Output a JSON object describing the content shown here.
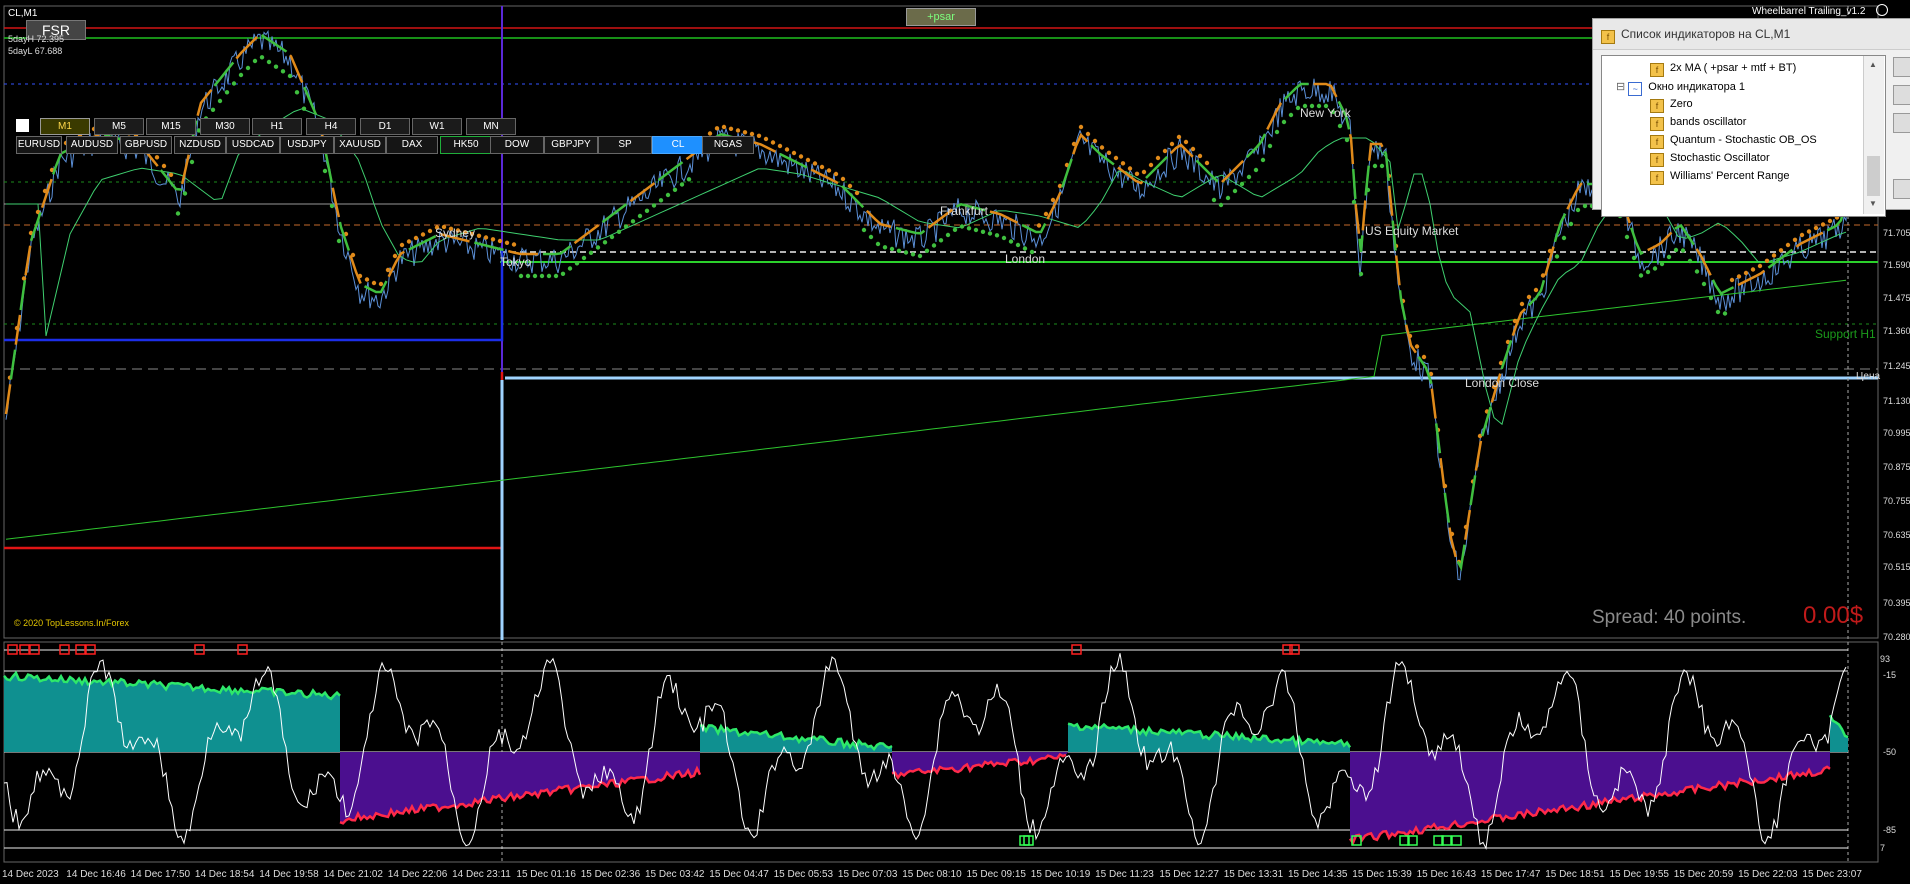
{
  "window": {
    "title": "CL,M1",
    "ea_label": "Wheelbarrel Trailing_v1.2",
    "indicator_tag": "+psar",
    "fsr_label": "FSR",
    "day_high": "5dayH 72.395",
    "day_low": "5dayL 67.688",
    "copyright": "© 2020 TopLessons.In/Forex",
    "spread": "Spread: 40 points.",
    "profit": "0.00$",
    "price_tag": "Цена"
  },
  "timeframes": [
    "M1",
    "M5",
    "M15",
    "M30",
    "H1",
    "H4",
    "D1",
    "W1",
    "MN"
  ],
  "active_timeframe": "M1",
  "symbols": [
    "EURUSD",
    "AUDUSD",
    "GBPUSD",
    "NZDUSD",
    "USDCAD",
    "USDJPY",
    "XAUUSD",
    "DAX",
    "HK50",
    "DOW",
    "GBPJPY",
    "SP",
    "CL",
    "NGAS"
  ],
  "active_symbol": "CL",
  "sessions": {
    "sydney": "Sydney",
    "tokyo": "Tokyo",
    "frankfurt": "Frankfurt",
    "london": "London",
    "new_york": "New York",
    "us_equity": "US Equity Market",
    "london_close": "London Close",
    "support": "Support H1"
  },
  "price_axis": [
    "71.705",
    "71.590",
    "71.475",
    "71.360",
    "71.245",
    "71.130",
    "70.995",
    "70.875",
    "70.755",
    "70.635",
    "70.515",
    "70.395",
    "70.280"
  ],
  "osc_axis": [
    "-15",
    "-50",
    "-85"
  ],
  "osc_marks": [
    "93",
    "7"
  ],
  "time_axis": [
    "14 Dec 2023",
    "14 Dec 16:46",
    "14 Dec 17:50",
    "14 Dec 18:54",
    "14 Dec 19:58",
    "14 Dec 21:02",
    "14 Dec 22:06",
    "14 Dec 23:11",
    "15 Dec 01:16",
    "15 Dec 02:36",
    "15 Dec 03:42",
    "15 Dec 04:47",
    "15 Dec 05:53",
    "15 Dec 07:03",
    "15 Dec 08:10",
    "15 Dec 09:15",
    "15 Dec 10:19",
    "15 Dec 11:23",
    "15 Dec 12:27",
    "15 Dec 13:31",
    "15 Dec 14:35",
    "15 Dec 15:39",
    "15 Dec 16:43",
    "15 Dec 17:47",
    "15 Dec 18:51",
    "15 Dec 19:55",
    "15 Dec 20:59",
    "15 Dec 22:03",
    "15 Dec 23:07"
  ],
  "indicator_panel": {
    "title": "Список индикаторов на CL,M1",
    "items": [
      {
        "label": "2x MA ( +psar + mtf + BT)",
        "type": "indicator"
      },
      {
        "label": "Окно индикатора 1",
        "type": "window"
      },
      {
        "label": "Zero",
        "type": "indicator"
      },
      {
        "label": "bands oscillator",
        "type": "indicator"
      },
      {
        "label": "Quantum - Stochastic OB_OS",
        "type": "indicator"
      },
      {
        "label": "Stochastic Oscillator",
        "type": "indicator"
      },
      {
        "label": "Williams' Percent Range",
        "type": "indicator"
      }
    ]
  },
  "colors": {
    "price_line": "#5b8fd6",
    "ma_orange": "#e08a1a",
    "ma_green": "#3fbf3f",
    "hist_teal": "#0f9090",
    "hist_purple": "#4b0f8f",
    "active_symbol": "#1e90ff",
    "session_blue": "#1c2ee8",
    "session_red": "#e01515"
  }
}
